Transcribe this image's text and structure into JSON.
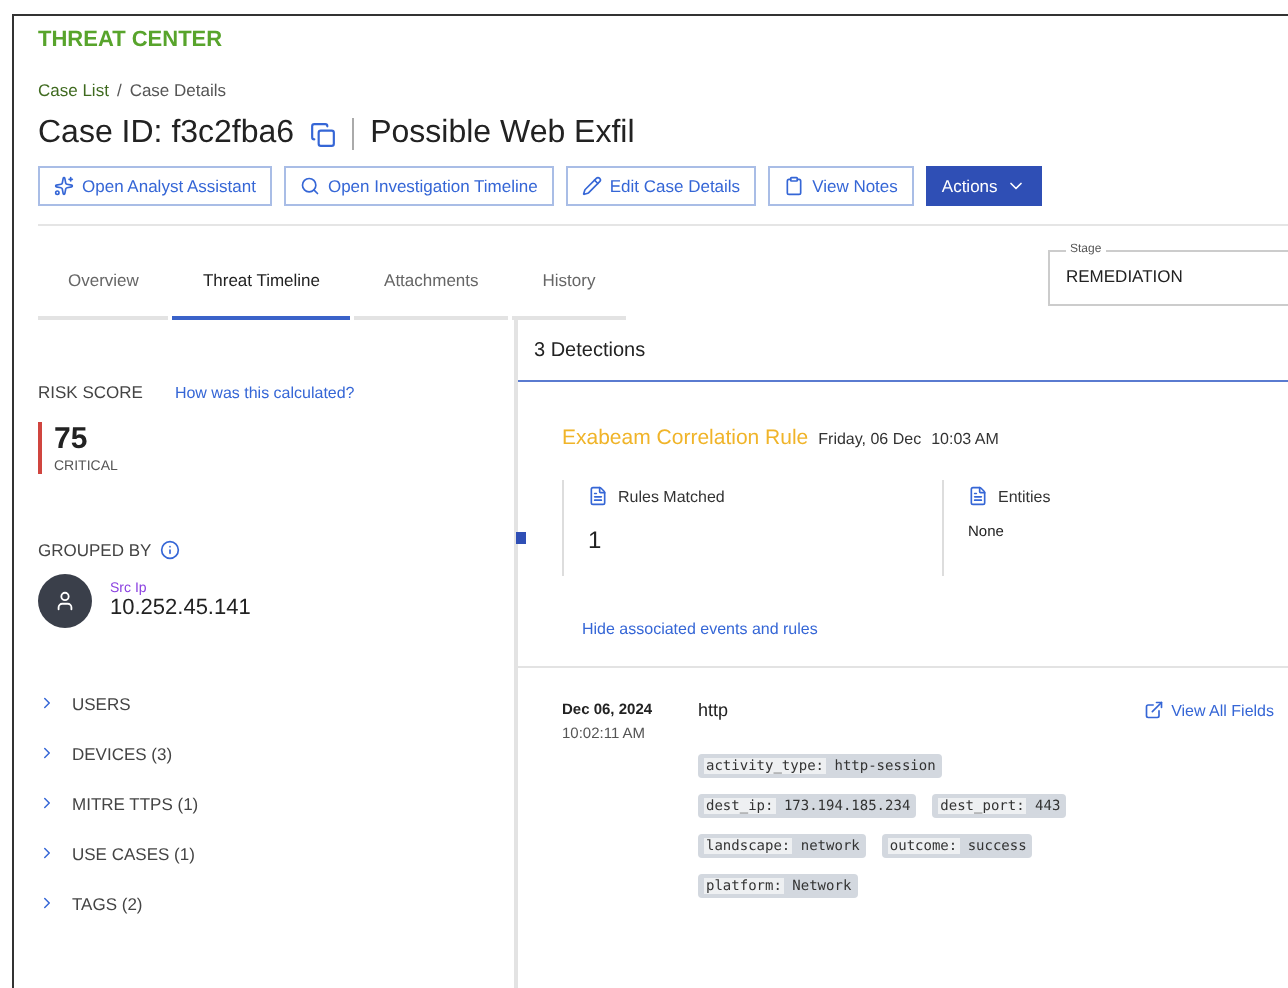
{
  "app_title": "THREAT CENTER",
  "breadcrumb": [
    {
      "label": "Case List",
      "kind": "link"
    },
    {
      "label": "/",
      "kind": "separator"
    },
    {
      "label": "Case Details",
      "kind": "current"
    }
  ],
  "case": {
    "id": "Case ID: f3c2fba6",
    "name": "Possible Web Exfil"
  },
  "buttons": [
    {
      "label": "Open Analyst Assistant",
      "kind": "outline"
    },
    {
      "label": "Open Investigation Timeline",
      "kind": "outline"
    },
    {
      "label": "Edit Case Details",
      "kind": "outline"
    },
    {
      "label": "View Notes",
      "kind": "outline"
    },
    {
      "label": "Actions",
      "kind": "primary"
    }
  ],
  "tabs": [
    {
      "label": "Overview",
      "selected": false
    },
    {
      "label": "Threat Timeline",
      "selected": true
    },
    {
      "label": "Attachments",
      "selected": false
    },
    {
      "label": "History",
      "selected": false
    }
  ],
  "stage": {
    "label": "Stage",
    "value": "REMEDIATION"
  },
  "risk": {
    "label": "RISK SCORE",
    "link": "How was this calculated?",
    "score": "75",
    "severity": "CRITICAL",
    "color": "#d0453f"
  },
  "grouped_by": {
    "label": "GROUPED BY",
    "field": "Src Ip",
    "value": "10.252.45.141"
  },
  "sections": [
    {
      "label": "USERS",
      "expanded": false
    },
    {
      "label": "DEVICES (3)",
      "expanded": false
    },
    {
      "label": "MITRE TTPS (1)",
      "expanded": false
    },
    {
      "label": "USE CASES (1)",
      "expanded": false
    },
    {
      "label": "TAGS (2)",
      "expanded": false
    }
  ],
  "detections": {
    "title": "3 Detections",
    "card": {
      "rule": "Exabeam Correlation Rule",
      "date": "Friday, 06 Dec",
      "time": "10:03 AM",
      "stats": [
        {
          "label": "Rules Matched",
          "value": "1",
          "kind": "big"
        },
        {
          "label": "Entities",
          "value": "None",
          "kind": "small"
        }
      ],
      "link": "Hide associated events and rules"
    },
    "event": {
      "date": "Dec 06, 2024",
      "time": "10:02:11 AM",
      "name": "http",
      "link": "View All Fields",
      "tag_rows": [
        [
          {
            "key": "activity_type:",
            "value": "http-session"
          }
        ],
        [
          {
            "key": "dest_ip:",
            "value": "173.194.185.234"
          },
          {
            "key": "dest_port:",
            "value": "443"
          }
        ],
        [
          {
            "key": "landscape:",
            "value": "network"
          },
          {
            "key": "outcome:",
            "value": "success"
          }
        ],
        [
          {
            "key": "platform:",
            "value": "Network"
          }
        ]
      ]
    }
  }
}
